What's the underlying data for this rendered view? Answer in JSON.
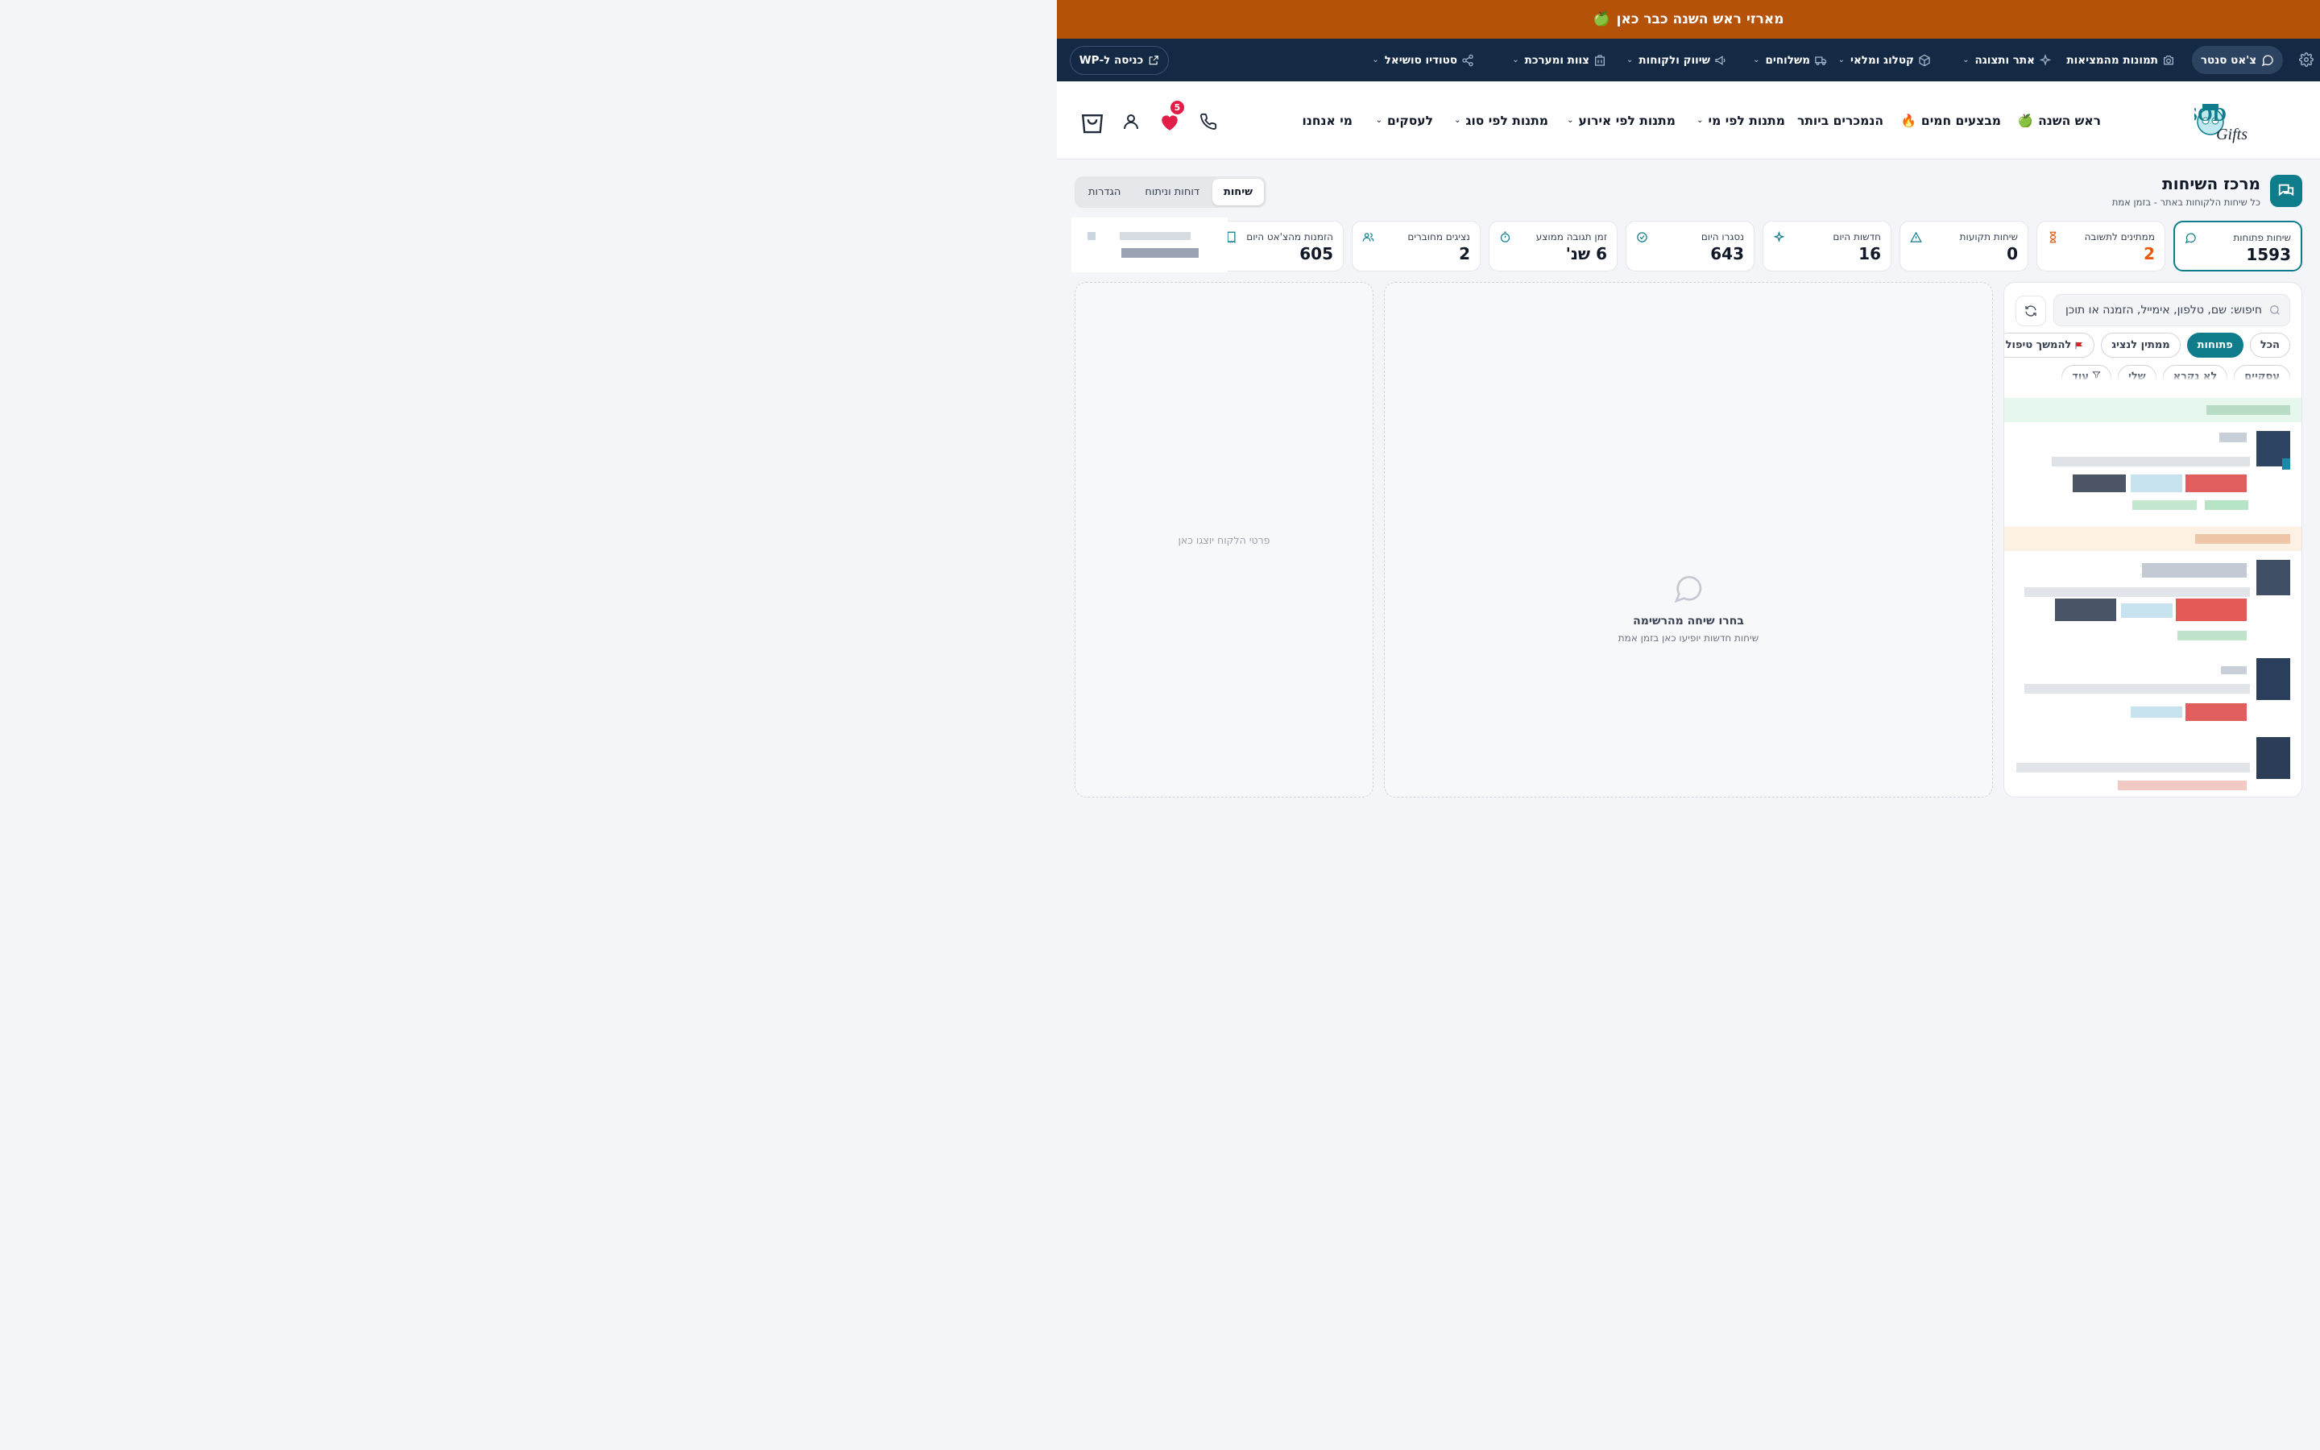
{
  "announcement": {
    "text": "מארזי ראש השנה כבר כאן",
    "icon": "🍏"
  },
  "admin_bar": {
    "chat_center": "צ'אט סנטר",
    "items": [
      {
        "label": "תמונות מהמציאות",
        "icon": "camera-icon",
        "has_dropdown": false
      },
      {
        "label": "אתר ותצוגה",
        "icon": "sparkles-icon",
        "has_dropdown": true
      },
      {
        "label": "קטלוג ומלאי",
        "icon": "box-icon",
        "has_dropdown": true
      },
      {
        "label": "משלוחים",
        "icon": "truck-icon",
        "has_dropdown": true
      },
      {
        "label": "שיווק ולקוחות",
        "icon": "megaphone-icon",
        "has_dropdown": true
      },
      {
        "label": "צוות ומערכת",
        "icon": "building-icon",
        "has_dropdown": true
      },
      {
        "label": "סטודיו סושיאל",
        "icon": "share-icon",
        "has_dropdown": true
      }
    ],
    "wp_login": "כניסה ל-WP"
  },
  "header": {
    "logo_text": "HASOD",
    "logo_sub": "Gifts",
    "nav": [
      {
        "label": "ראש השנה",
        "emoji": "🍏",
        "has_dropdown": false
      },
      {
        "label": "מבצעים חמים",
        "emoji": "🔥",
        "has_dropdown": false
      },
      {
        "label": "הנמכרים ביותר",
        "emoji": "",
        "has_dropdown": false
      },
      {
        "label": "מתנות לפי מי",
        "emoji": "",
        "has_dropdown": true
      },
      {
        "label": "מתנות לפי אירוע",
        "emoji": "",
        "has_dropdown": true
      },
      {
        "label": "מתנות לפי סוג",
        "emoji": "",
        "has_dropdown": true
      },
      {
        "label": "לעסקים",
        "emoji": "",
        "has_dropdown": true
      },
      {
        "label": "מי אנחנו",
        "emoji": "",
        "has_dropdown": false
      }
    ],
    "wishlist_count": "5"
  },
  "page": {
    "title": "מרכז השיחות",
    "subtitle": "כל שיחות הלקוחות באתר - בזמן אמת",
    "tabs": [
      "שיחות",
      "דוחות וניתוח",
      "הגדרות"
    ],
    "active_tab": "שיחות"
  },
  "stats": [
    {
      "label": "שיחות פתוחות",
      "value": "1593",
      "icon": "chat-bubble-icon",
      "color": "#0f7c8c"
    },
    {
      "label": "ממתינים לתשובה",
      "value": "2",
      "icon": "hourglass-icon",
      "color": "#ea580c"
    },
    {
      "label": "שיחות תקועות",
      "value": "0",
      "icon": "warning-icon",
      "color": "#0f7c8c"
    },
    {
      "label": "חדשות היום",
      "value": "16",
      "icon": "sparkle-icon",
      "color": "#0f7c8c"
    },
    {
      "label": "נסגרו היום",
      "value": "643",
      "icon": "check-circle-icon",
      "color": "#0f7c8c"
    },
    {
      "label": "זמן תגובה ממוצע",
      "value": "6 שנ'",
      "icon": "stopwatch-icon",
      "color": "#0f7c8c"
    },
    {
      "label": "נציגים מחוברים",
      "value": "2",
      "icon": "users-icon",
      "color": "#0f7c8c"
    },
    {
      "label": "הזמנות מהצ'אט היום",
      "value": "605",
      "icon": "receipt-icon",
      "color": "#0f7c8c"
    }
  ],
  "customer_panel": {
    "placeholder": "פרטי הלקוח יוצגו כאן"
  },
  "conversation_panel": {
    "title": "בחרו שיחה מהרשימה",
    "subtitle": "שיחות חדשות יופיעו כאן בזמן אמת"
  },
  "list": {
    "search_placeholder": "חיפוש: שם, טלפון, אימייל, הזמנה או תוכן",
    "filters": [
      "הכל",
      "פתוחות",
      "ממתין לנציג",
      "להמשך טיפול"
    ],
    "active_filter": "פתוחות",
    "filters_row2": [
      "עסקיים",
      "לא נקרא",
      "שלי",
      "עוד"
    ]
  },
  "colors": {
    "accent": "#0f7c8c",
    "announcement": "#b4520a",
    "admin_bar": "#142a44",
    "badge": "#e11d48"
  }
}
